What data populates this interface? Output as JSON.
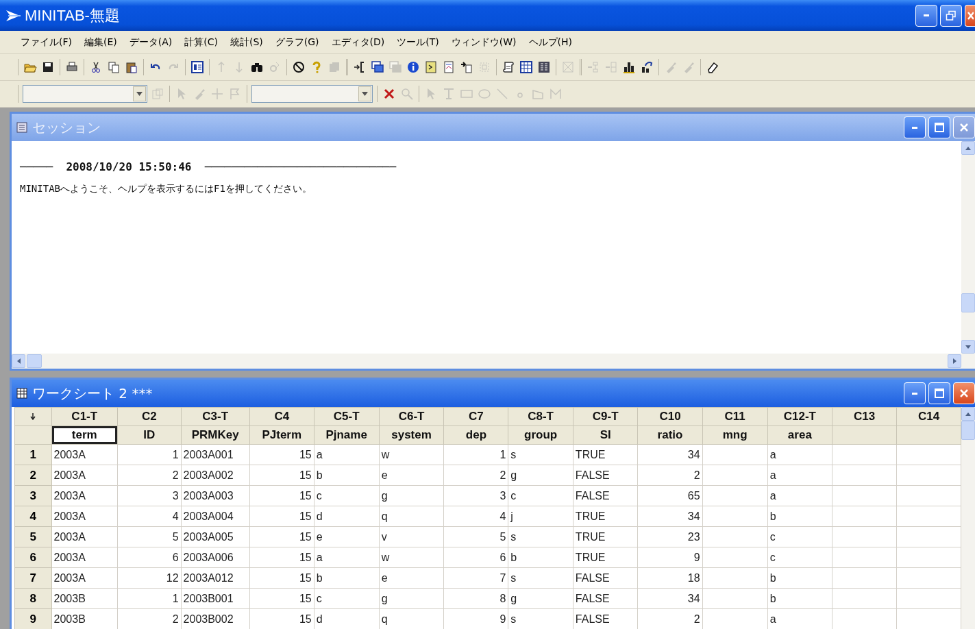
{
  "window": {
    "title": "MINITAB-無題"
  },
  "menu": [
    "ファイル(F)",
    "編集(E)",
    "データ(A)",
    "計算(C)",
    "統計(S)",
    "グラフ(G)",
    "エディタ(D)",
    "ツール(T)",
    "ウィンドウ(W)",
    "ヘルプ(H)"
  ],
  "toolbar_1": [
    [
      {
        "disabled": false
      },
      {
        "disabled": false
      }
    ],
    [
      {
        "disabled": false
      }
    ],
    [
      {
        "disabled": false
      },
      {
        "disabled": false
      },
      {
        "disabled": false
      }
    ],
    [
      {
        "disabled": false
      },
      {
        "disabled": true
      }
    ],
    [
      {
        "disabled": false
      }
    ],
    [
      {
        "disabled": true
      },
      {
        "disabled": true
      },
      {
        "disabled": false
      },
      {
        "disabled": true
      }
    ],
    [
      {
        "disabled": false
      },
      {
        "disabled": false
      },
      {
        "disabled": true
      }
    ],
    [
      {
        "disabled": false
      },
      {
        "disabled": false
      },
      {
        "disabled": true
      },
      {
        "disabled": false
      },
      {
        "disabled": false
      },
      {
        "disabled": false
      },
      {
        "disabled": false
      },
      {
        "disabled": true
      }
    ],
    [
      {
        "disabled": false
      },
      {
        "disabled": false
      },
      {
        "disabled": false
      }
    ],
    [
      {
        "disabled": true
      }
    ],
    [
      {
        "disabled": true
      },
      {
        "disabled": true
      },
      {
        "disabled": false
      },
      {
        "disabled": false
      }
    ],
    [
      {
        "disabled": true
      },
      {
        "disabled": true
      }
    ],
    [
      {
        "disabled": false
      }
    ]
  ],
  "toolbar_2": [
    [
      {
        "kind": "combo",
        "disabled": true
      },
      {
        "kind": "button",
        "disabled": true
      }
    ],
    [
      {
        "kind": "button",
        "disabled": true
      },
      {
        "kind": "button",
        "disabled": true
      },
      {
        "kind": "button",
        "disabled": true
      },
      {
        "kind": "button",
        "disabled": true
      }
    ],
    [
      {
        "kind": "combo",
        "disabled": true
      }
    ],
    [
      {
        "kind": "button",
        "disabled": false
      },
      {
        "kind": "button",
        "disabled": true
      }
    ],
    [
      {
        "kind": "button",
        "disabled": true
      },
      {
        "kind": "button",
        "disabled": true
      },
      {
        "kind": "button",
        "disabled": true
      },
      {
        "kind": "button",
        "disabled": true
      },
      {
        "kind": "button",
        "disabled": true
      },
      {
        "kind": "button",
        "disabled": true
      },
      {
        "kind": "button",
        "disabled": true
      },
      {
        "kind": "button",
        "disabled": true
      }
    ]
  ],
  "session": {
    "title": "セッション",
    "lines": [
      "─────  2008/10/20 15:50:46  ─────────────────────────────",
      "MINITABへようこそ、ヘルプを表示するにはF1を押してください。"
    ]
  },
  "worksheet": {
    "title": "ワークシート 2 ***",
    "columns": [
      {
        "id": "C1-T",
        "name": "term",
        "kind": "text",
        "selected": true
      },
      {
        "id": "C2",
        "name": "ID",
        "kind": "number",
        "selected": false
      },
      {
        "id": "C3-T",
        "name": "PRMKey",
        "kind": "text",
        "selected": false
      },
      {
        "id": "C4",
        "name": "PJterm",
        "kind": "number",
        "selected": false
      },
      {
        "id": "C5-T",
        "name": "Pjname",
        "kind": "text",
        "selected": false
      },
      {
        "id": "C6-T",
        "name": "system",
        "kind": "text",
        "selected": false
      },
      {
        "id": "C7",
        "name": "dep",
        "kind": "number",
        "selected": false
      },
      {
        "id": "C8-T",
        "name": "group",
        "kind": "text",
        "selected": false
      },
      {
        "id": "C9-T",
        "name": "SI",
        "kind": "text",
        "selected": false
      },
      {
        "id": "C10",
        "name": "ratio",
        "kind": "number",
        "selected": false
      },
      {
        "id": "C11",
        "name": "mng",
        "kind": "number",
        "selected": false
      },
      {
        "id": "C12-T",
        "name": "area",
        "kind": "text",
        "selected": false
      },
      {
        "id": "C13",
        "kind": "number",
        "selected": false
      },
      {
        "id": "C14",
        "kind": "number",
        "selected": false
      }
    ],
    "rows": [
      {
        "num": "1",
        "cells": [
          "2003A",
          "1",
          "2003A001",
          "15",
          "a",
          "w",
          "1",
          "s",
          "TRUE",
          "34",
          "",
          "a",
          "",
          ""
        ]
      },
      {
        "num": "2",
        "cells": [
          "2003A",
          "2",
          "2003A002",
          "15",
          "b",
          "e",
          "2",
          "g",
          "FALSE",
          "2",
          "",
          "a",
          "",
          ""
        ]
      },
      {
        "num": "3",
        "cells": [
          "2003A",
          "3",
          "2003A003",
          "15",
          "c",
          "g",
          "3",
          "c",
          "FALSE",
          "65",
          "",
          "a",
          "",
          ""
        ]
      },
      {
        "num": "4",
        "cells": [
          "2003A",
          "4",
          "2003A004",
          "15",
          "d",
          "q",
          "4",
          "j",
          "TRUE",
          "34",
          "",
          "b",
          "",
          ""
        ]
      },
      {
        "num": "5",
        "cells": [
          "2003A",
          "5",
          "2003A005",
          "15",
          "e",
          "v",
          "5",
          "s",
          "TRUE",
          "23",
          "",
          "c",
          "",
          ""
        ]
      },
      {
        "num": "6",
        "cells": [
          "2003A",
          "6",
          "2003A006",
          "15",
          "a",
          "w",
          "6",
          "b",
          "TRUE",
          "9",
          "",
          "c",
          "",
          ""
        ]
      },
      {
        "num": "7",
        "cells": [
          "2003A",
          "12",
          "2003A012",
          "15",
          "b",
          "e",
          "7",
          "s",
          "FALSE",
          "18",
          "",
          "b",
          "",
          ""
        ]
      },
      {
        "num": "8",
        "cells": [
          "2003B",
          "1",
          "2003B001",
          "15",
          "c",
          "g",
          "8",
          "g",
          "FALSE",
          "34",
          "",
          "b",
          "",
          ""
        ]
      },
      {
        "num": "9",
        "cells": [
          "2003B",
          "2",
          "2003B002",
          "15",
          "d",
          "q",
          "9",
          "s",
          "FALSE",
          "2",
          "",
          "a",
          "",
          ""
        ]
      }
    ]
  }
}
